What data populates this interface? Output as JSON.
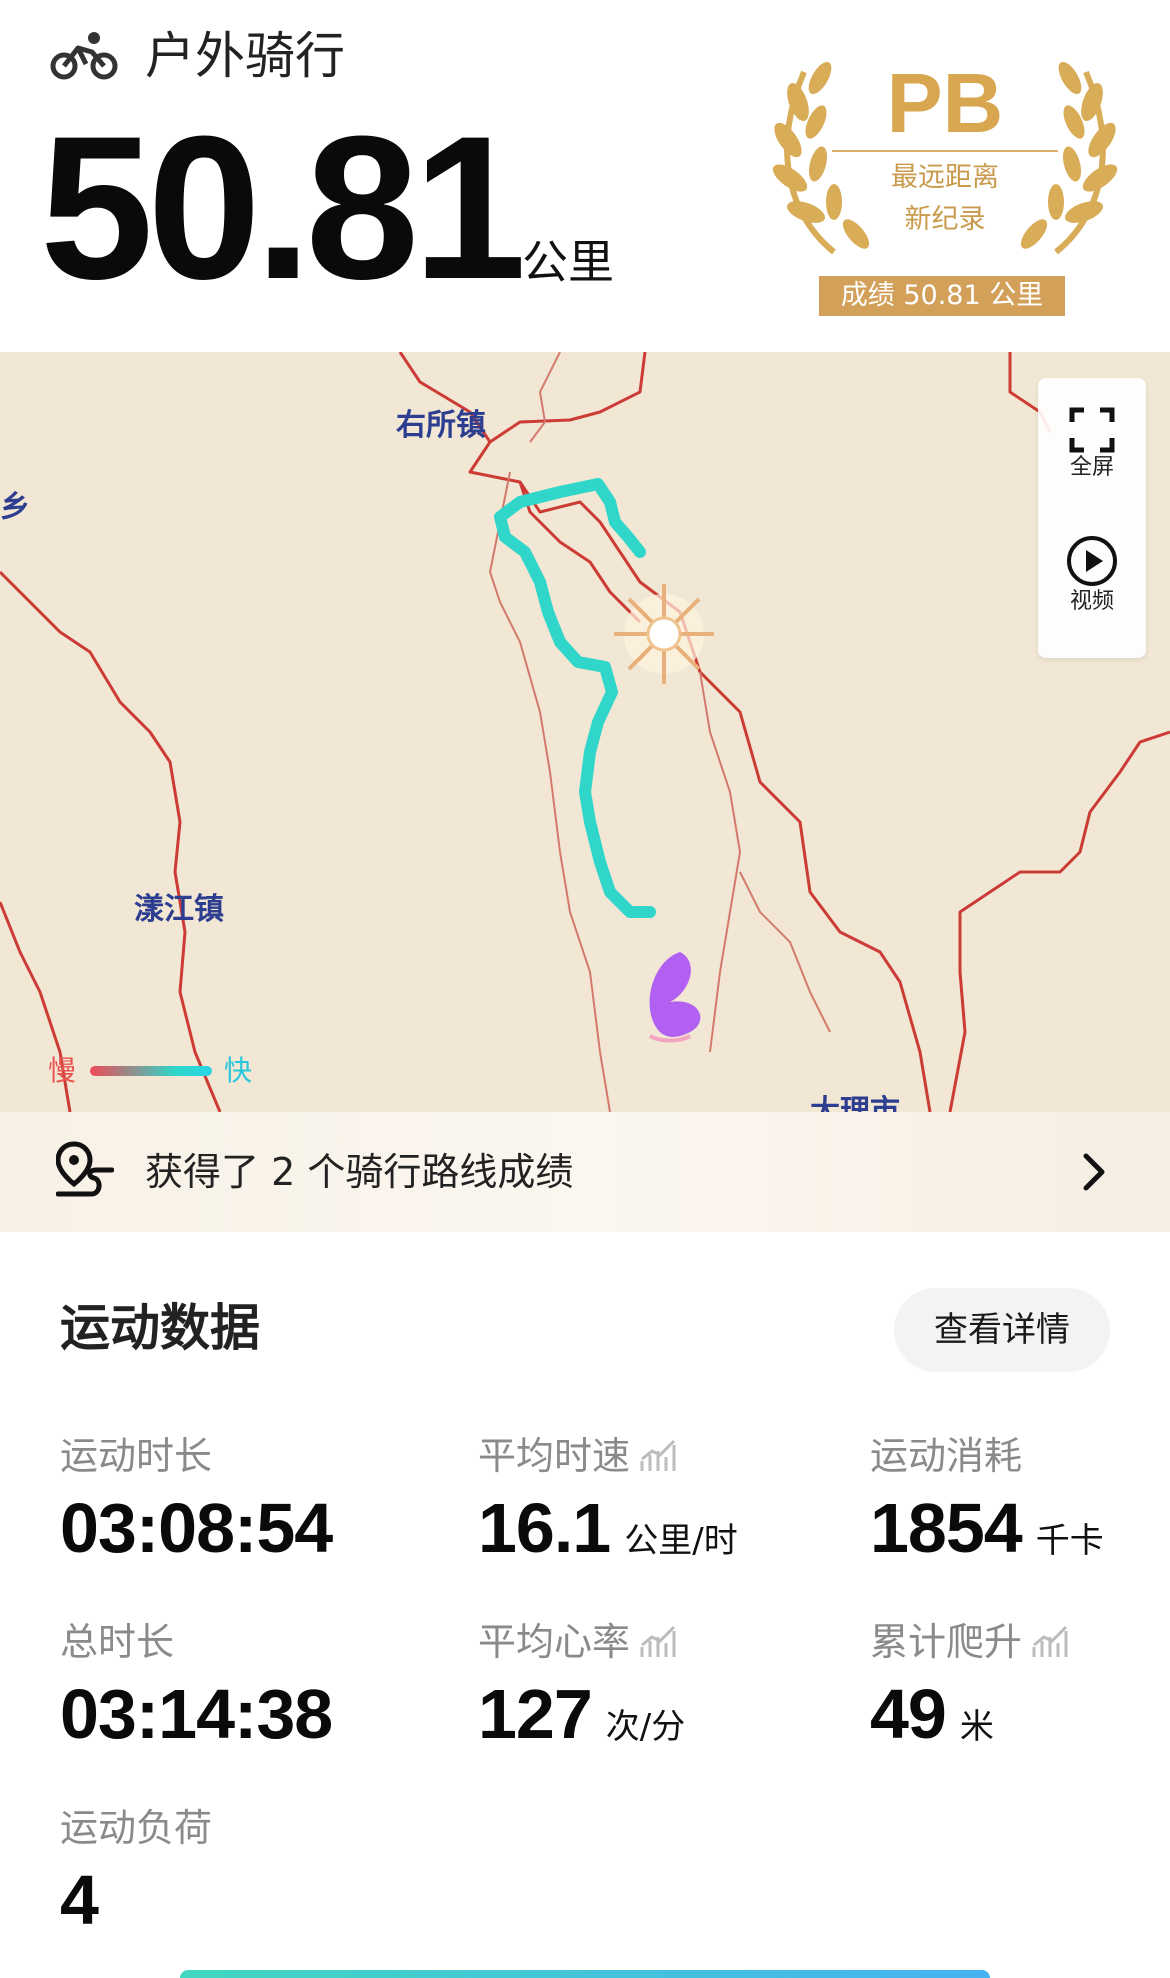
{
  "header": {
    "sport_icon": "bicycle-icon",
    "sport_title": "户外骑行",
    "distance_value": "50.81",
    "distance_unit": "公里"
  },
  "pb_badge": {
    "icon": "laurel-wreath-icon",
    "title": "PB",
    "line1": "最远距离",
    "line2": "新纪录",
    "score": "成绩 50.81 公里",
    "color": "#d8a64e"
  },
  "map": {
    "places": [
      "右所镇",
      "乡",
      "漾江镇",
      "大理市"
    ],
    "controls": [
      {
        "icon": "fullscreen-icon",
        "label": "全屏"
      },
      {
        "icon": "play-circle-icon",
        "label": "视频"
      }
    ],
    "legend": {
      "slow": "慢",
      "fast": "快"
    },
    "route_color": "#2fd6c9",
    "start_marker": "sun-marker-icon",
    "end_marker": "butterfly-marker-icon"
  },
  "route_banner": {
    "icon": "route-pin-icon",
    "text": "获得了 2 个骑行路线成绩",
    "chevron": "chevron-right-icon"
  },
  "stats": {
    "title": "运动数据",
    "details_button": "查看详情",
    "items": [
      {
        "label": "运动时长",
        "value": "03:08:54",
        "unit": ""
      },
      {
        "label": "平均时速",
        "value": "16.1",
        "unit": "公里/时",
        "trend_icon": "trend-chart-icon"
      },
      {
        "label": "运动消耗",
        "value": "1854",
        "unit": "千卡"
      },
      {
        "label": "总时长",
        "value": "03:14:38",
        "unit": ""
      },
      {
        "label": "平均心率",
        "value": "127",
        "unit": "次/分",
        "trend_icon": "trend-chart-icon"
      },
      {
        "label": "累计爬升",
        "value": "49",
        "unit": "米",
        "trend_icon": "trend-chart-icon"
      },
      {
        "label": "运动负荷",
        "value": "4",
        "unit": ""
      }
    ]
  }
}
